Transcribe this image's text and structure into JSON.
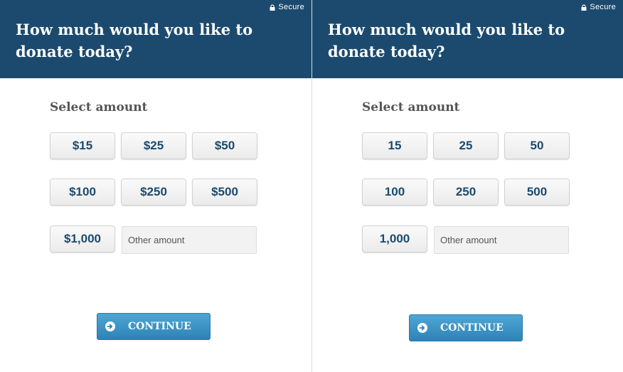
{
  "panels": [
    {
      "secure": "Secure",
      "title": "How much would you like to donate today?",
      "select_label": "Select amount",
      "amounts": [
        "$15",
        "$25",
        "$50",
        "$100",
        "$250",
        "$500",
        "$1,000"
      ],
      "other_placeholder": "Other amount",
      "continue": "CONTINUE",
      "lock_icon": "lock-icon",
      "continue_icon": "arrow-right-circle-icon"
    },
    {
      "secure": "Secure",
      "title": "How much would you like to donate today?",
      "select_label": "Select amount",
      "amounts": [
        "15",
        "25",
        "50",
        "100",
        "250",
        "500",
        "1,000"
      ],
      "other_placeholder": "Other amount",
      "continue": "CONTINUE",
      "lock_icon": "lock-icon",
      "continue_icon": "arrow-right-circle-icon"
    }
  ],
  "colors": {
    "header": "#1b4a6e",
    "amount_text": "#1b4a6e",
    "label_text": "#555555",
    "continue_button": "#3b93c4"
  }
}
